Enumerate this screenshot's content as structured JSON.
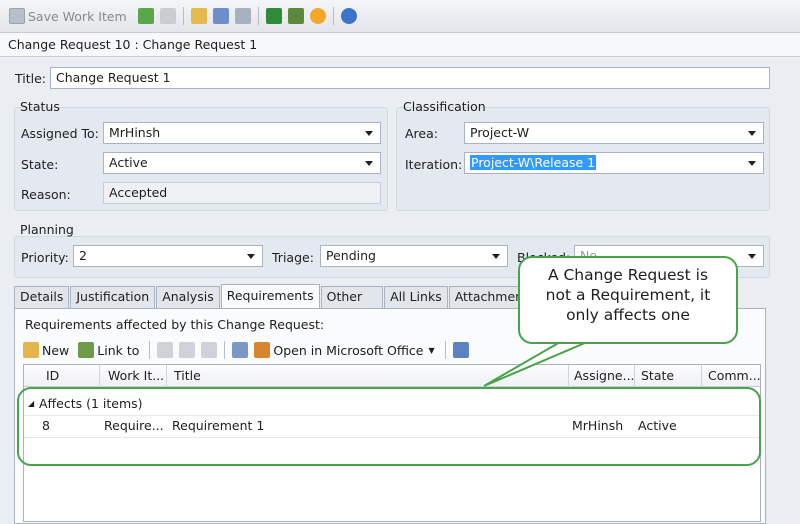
{
  "toolbar": {
    "save_label": "Save Work Item"
  },
  "window_title": "Change Request 10 : Change Request 1",
  "title": {
    "label": "Title:",
    "value": "Change Request 1"
  },
  "status": {
    "heading": "Status",
    "assigned_to": {
      "label": "Assigned To:",
      "value": "MrHinsh"
    },
    "state": {
      "label": "State:",
      "value": "Active"
    },
    "reason": {
      "label": "Reason:",
      "value": "Accepted"
    }
  },
  "classification": {
    "heading": "Classification",
    "area": {
      "label": "Area:",
      "value": "Project-W"
    },
    "iteration": {
      "label": "Iteration:",
      "value": "Project-W\\Release 1"
    }
  },
  "planning": {
    "heading": "Planning",
    "priority": {
      "label": "Priority:",
      "value": "2"
    },
    "triage": {
      "label": "Triage:",
      "value": "Pending"
    },
    "blocked": {
      "label": "Blocked:",
      "value": "No"
    }
  },
  "tabs": [
    {
      "label": "Details"
    },
    {
      "label": "Justification"
    },
    {
      "label": "Analysis"
    },
    {
      "label": "Requirements"
    },
    {
      "label": "Other"
    },
    {
      "label": "All Links"
    },
    {
      "label": "Attachments"
    }
  ],
  "requirements": {
    "caption": "Requirements affected by this Change Request:",
    "new_label": "New",
    "link_label": "Link to",
    "office_label": "Open in Microsoft Office",
    "columns": [
      "ID",
      "Work It...",
      "Title",
      "Assigne...",
      "State",
      "Comm..."
    ],
    "group_label": "Affects (1 items)",
    "rows": [
      {
        "id": "8",
        "work_item": "Require...",
        "title": "Requirement 1",
        "assigned": "MrHinsh",
        "state": "Active",
        "comment": ""
      }
    ]
  },
  "callout": {
    "line1": "A Change Request is",
    "line2": "not a Requirement, it",
    "line3": "only affects one"
  },
  "colors": {
    "highlight": "#49a34a",
    "selection": "#3399ff"
  }
}
